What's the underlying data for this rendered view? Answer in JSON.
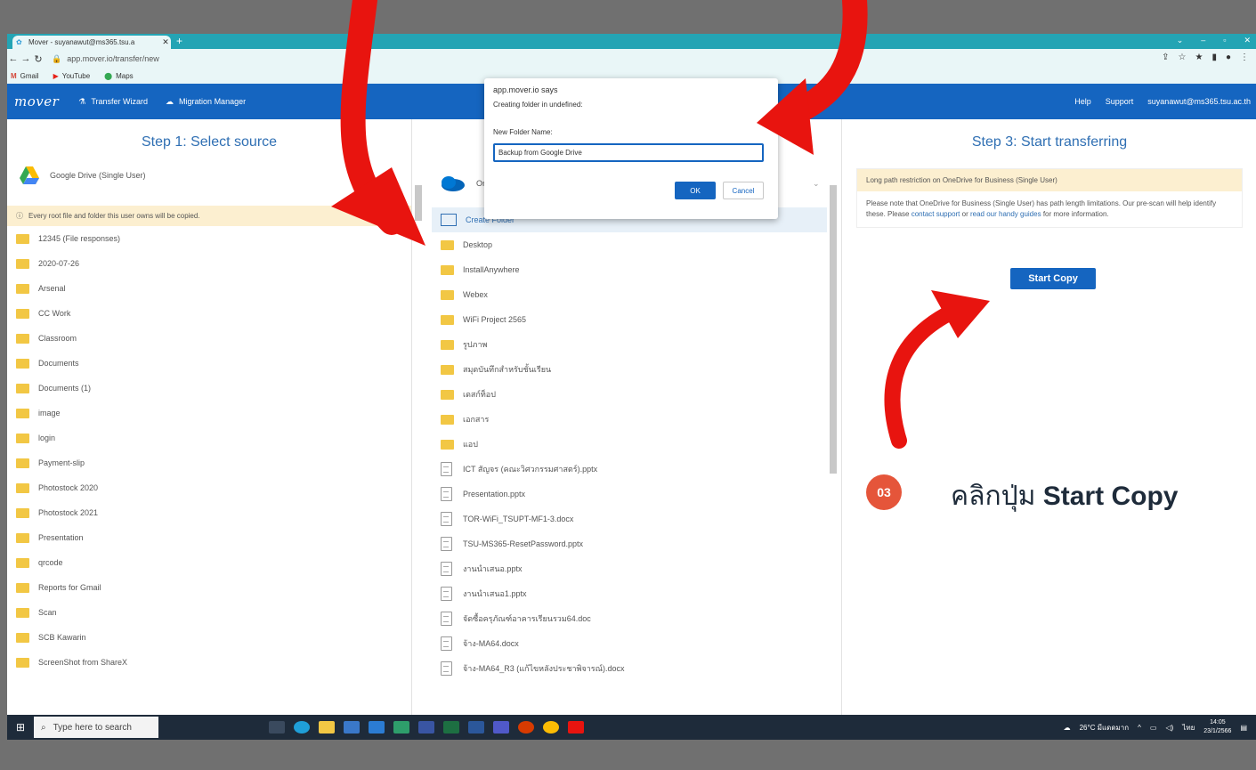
{
  "browser": {
    "tab_title": "Mover - suyanawut@ms365.tsu.a",
    "new_tab": "+",
    "url": "app.mover.io/transfer/new",
    "window_controls": [
      "⌄",
      "–",
      "▫",
      "✕"
    ]
  },
  "bookmarks": [
    {
      "label": "Gmail",
      "icon": "gmail-icon",
      "color": "#d44638"
    },
    {
      "label": "YouTube",
      "icon": "youtube-icon",
      "color": "#e62117"
    },
    {
      "label": "Maps",
      "icon": "maps-icon",
      "color": "#34a853"
    }
  ],
  "appbar": {
    "logo": "mover",
    "transfer_wizard": "Transfer Wizard",
    "migration_manager": "Migration Manager",
    "help": "Help",
    "support": "Support",
    "user": "suyanawut@ms365.tsu.ac.th"
  },
  "step1": {
    "title": "Step 1: Select source",
    "provider": "Google Drive (Single User)",
    "notice": "Every root file and folder this user owns will be copied.",
    "items": [
      "12345 (File responses)",
      "2020-07-26",
      "Arsenal",
      "CC Work",
      "Classroom",
      "Documents",
      "Documents (1)",
      "image",
      "login",
      "Payment-slip",
      "Photostock 2020",
      "Photostock 2021",
      "Presentation",
      "qrcode",
      "Reports for Gmail",
      "Scan",
      "SCB Kawarin",
      "ScreenShot from ShareX"
    ]
  },
  "step2": {
    "provider_partial": "On",
    "create_folder": "Create Folder",
    "folders": [
      "Desktop",
      "InstallAnywhere",
      "Webex",
      "WiFi Project 2565",
      "รูปภาพ",
      "สมุดบันทึกสำหรับชั้นเรียน",
      "เดสก์ท็อป",
      "เอกสาร",
      "แอป"
    ],
    "files": [
      "ICT สัญจร (คณะวิศวกรรมศาสตร์).pptx",
      "Presentation.pptx",
      "TOR-WiFi_TSUPT-MF1-3.docx",
      "TSU-MS365-ResetPassword.pptx",
      "งานนำเสนอ.pptx",
      "งานนำเสนอ1.pptx",
      "จัดซื้อครุภัณฑ์อาคารเรียนรวม64.doc",
      "จ้าง-MA64.docx",
      "จ้าง-MA64_R3 (แก้ไขหลังประชาพิจารณ์).docx"
    ]
  },
  "step3": {
    "title": "Step 3: Start transferring",
    "warning_title": "Long path restriction on OneDrive for Business (Single User)",
    "warning_text_1": "Please note that OneDrive for Business (Single User) has path length limitations. Our pre-scan will help identify these. Please ",
    "contact_support": "contact support",
    "warning_text_2": " or ",
    "handy_guides": "read our handy guides",
    "warning_text_3": " for more information.",
    "start_copy": "Start Copy"
  },
  "dialog": {
    "origin": "app.mover.io says",
    "message": "Creating folder in undefined:",
    "label": "New Folder Name:",
    "value": "Backup from Google Drive",
    "ok": "OK",
    "cancel": "Cancel"
  },
  "taskbar": {
    "search_placeholder": "Type here to search",
    "weather": "26°C มีแดดมาก",
    "lang": "ไทย",
    "time": "14:05",
    "date": "23/1/2566"
  },
  "overlay": {
    "badge": "03",
    "caption_prefix": "คลิกปุ่ม ",
    "caption_bold": "Start Copy"
  },
  "colors": {
    "accent": "#1565c0",
    "arrow": "#e8140f",
    "badge": "#e5553a",
    "tabbar": "#24a4b4"
  }
}
